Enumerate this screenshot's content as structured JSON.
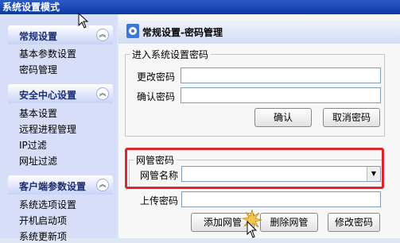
{
  "window": {
    "title": "系统设置模式"
  },
  "sidebar": {
    "sections": [
      {
        "title": "常规设置",
        "items": [
          "基本参数设置",
          "密码管理"
        ]
      },
      {
        "title": "安全中心设置",
        "items": [
          "基本设置",
          "远程进程管理",
          "IP过滤",
          "网址过滤"
        ]
      },
      {
        "title": "客户端参数设置",
        "items": [
          "系统选项设置",
          "开机启动项",
          "系统更新项"
        ]
      }
    ]
  },
  "header": {
    "title": "常规设置-密码管理"
  },
  "system_password": {
    "legend": "进入系统设置密码",
    "change_label": "更改密码",
    "change_value": "",
    "confirm_label": "确认密码",
    "confirm_value": "",
    "confirm_button": "确认",
    "cancel_button": "取消密码"
  },
  "netbar_password": {
    "legend": "网管密码",
    "name_label": "网管名称",
    "name_value": "",
    "upload_label": "上传密码",
    "upload_value": ""
  },
  "actions": {
    "add": "添加网管",
    "delete": "删除网管",
    "modify": "修改密码"
  },
  "colors": {
    "highlight": "#e0262c",
    "title_bar": "#0a3aa6"
  }
}
